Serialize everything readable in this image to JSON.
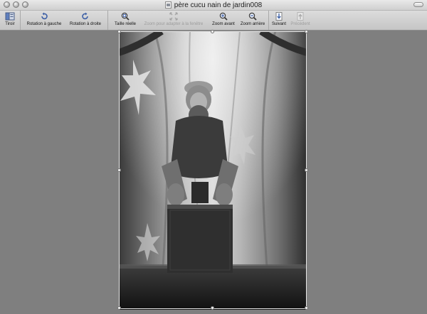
{
  "window": {
    "title": "père cucu nain de jardin008",
    "title_icon": "document-image-icon"
  },
  "toolbar": {
    "items": [
      {
        "label": "Tiroir",
        "icon": "drawer-icon",
        "enabled": true
      },
      {
        "label": "Rotation à gauche",
        "icon": "rotate-left-icon",
        "enabled": true
      },
      {
        "label": "Rotation à droite",
        "icon": "rotate-right-icon",
        "enabled": true
      },
      {
        "label": "Taille réelle",
        "icon": "actual-size-icon",
        "enabled": true
      },
      {
        "label": "Zoom pour adapter à la fenêtre",
        "icon": "zoom-to-fit-icon",
        "enabled": false
      },
      {
        "label": "Zoom avant",
        "icon": "zoom-in-icon",
        "enabled": true
      },
      {
        "label": "Zoom arrière",
        "icon": "zoom-out-icon",
        "enabled": true
      },
      {
        "label": "Suivant",
        "icon": "next-icon",
        "enabled": true
      },
      {
        "label": "Précédent",
        "icon": "previous-icon",
        "enabled": false
      }
    ]
  },
  "document": {
    "image_alt": "",
    "selection_active": true
  },
  "colors": {
    "background": "#7f7f7f",
    "toolbar": "#cfcfcf",
    "icon_blue": "#3c5fa6"
  }
}
